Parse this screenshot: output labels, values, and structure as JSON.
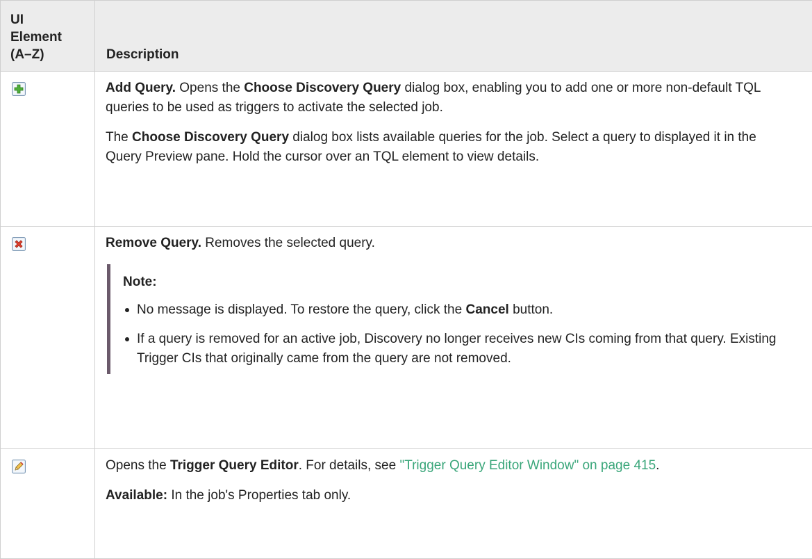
{
  "headers": {
    "col1": [
      "UI",
      "Element",
      "(A–Z)"
    ],
    "col2": "Description"
  },
  "rows": [
    {
      "icon": "add-icon",
      "p1": {
        "b1": "Add Query.",
        "t1": " Opens the ",
        "b2": "Choose Discovery Query",
        "t2": " dialog box, enabling you to add one or more non-default TQL queries to be used as triggers to activate the selected job."
      },
      "p2": {
        "t0": "The ",
        "b1": "Choose Discovery Query",
        "t1": " dialog box lists available queries for the job. Select a query to displayed it in the Query Preview pane. Hold the cursor over an TQL element to view details."
      }
    },
    {
      "icon": "remove-icon",
      "p1": {
        "b1": "Remove Query.",
        "t1": " Removes the selected query."
      },
      "note": {
        "title": "Note:",
        "items": [
          {
            "t1": "No message is displayed. To restore the query, click the ",
            "b1": "Cancel",
            "t2": " button."
          },
          {
            "t1": "If a query is removed for an active job, Discovery no longer receives new CIs coming from that query. Existing Trigger CIs that originally came from the query are not removed."
          }
        ]
      }
    },
    {
      "icon": "edit-icon",
      "p1": {
        "t0": "Opens the ",
        "b1": "Trigger Query Editor",
        "t1": ". For details, see ",
        "link": "\"Trigger Query Editor Window\" on page 415",
        "t2": "."
      },
      "p2": {
        "b1": "Available:",
        "t1": " In the job's Properties tab only."
      }
    }
  ],
  "colors": {
    "link": "#3aa67a",
    "header_bg": "#ececec",
    "note_bar": "#6b5a6b"
  }
}
